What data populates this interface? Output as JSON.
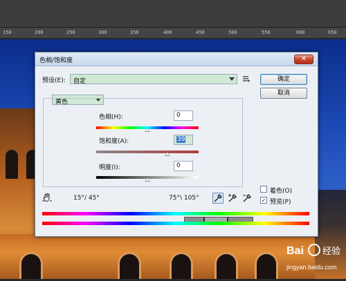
{
  "ruler": {
    "ticks": [
      "150",
      "200",
      "250",
      "300",
      "350",
      "400",
      "450",
      "500",
      "550",
      "600",
      "650"
    ]
  },
  "dialog": {
    "title": "色相/饱和度",
    "close_glyph": "✕",
    "preset_label": "预设(E):",
    "preset_value": "自定",
    "ok_label": "确定",
    "cancel_label": "取消",
    "channel_value": "黄色",
    "hue_label": "色相(H):",
    "hue_value": "0",
    "saturation_label": "饱和度(A):",
    "saturation_value": "39",
    "lightness_label": "明度(I):",
    "lightness_value": "0",
    "range_left": "15°/ 45°",
    "range_right": "75°\\ 105°",
    "colorize_label": "着色(O)",
    "colorize_checked": false,
    "preview_label": "预览(P)",
    "preview_checked": true,
    "hue_level": 0.5,
    "saturation_level": 0.695,
    "lightness_level": 0.5
  },
  "icons": {
    "preset_menu": "preset-options-icon",
    "hand": "hand-adjust-icon",
    "eyedropper": "eyedropper-icon",
    "eyedropper_plus": "eyedropper-plus-icon",
    "eyedropper_minus": "eyedropper-minus-icon"
  },
  "watermark": {
    "brand": "Bai",
    "brand2": "经验",
    "url": "jingyan.baidu.com"
  },
  "colors": {
    "green_field": "#cfe9d4",
    "default_button": "#3c7fb1",
    "dialog_bg": "#ecf0f5"
  }
}
